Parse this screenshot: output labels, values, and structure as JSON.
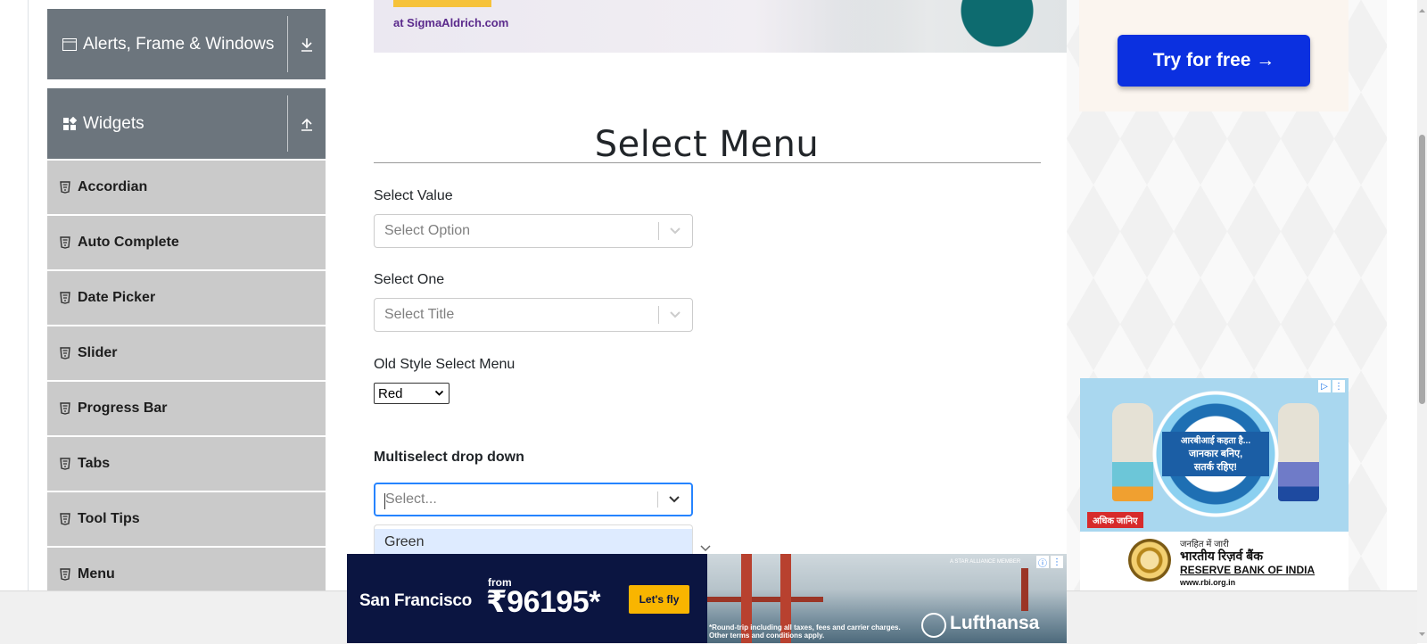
{
  "sidebar": {
    "groups": [
      {
        "label": "Alerts, Frame & Windows",
        "icon": "window-icon",
        "toggle_icon": "expand-down-icon"
      },
      {
        "label": "Widgets",
        "icon": "widgets-grid-icon",
        "toggle_icon": "collapse-up-icon"
      }
    ],
    "items": [
      {
        "label": "Accordian"
      },
      {
        "label": "Auto Complete"
      },
      {
        "label": "Date Picker"
      },
      {
        "label": "Slider"
      },
      {
        "label": "Progress Bar"
      },
      {
        "label": "Tabs"
      },
      {
        "label": "Tool Tips"
      },
      {
        "label": "Menu"
      }
    ]
  },
  "top_ad": {
    "url": "at SigmaAldrich.com"
  },
  "main": {
    "title": "Select Menu",
    "select_value": {
      "label": "Select Value",
      "placeholder": "Select Option"
    },
    "select_one": {
      "label": "Select One",
      "placeholder": "Select Title"
    },
    "old_style": {
      "label": "Old Style Select Menu",
      "value": "Red"
    },
    "multiselect": {
      "label": "Multiselect drop down",
      "placeholder": "Select...",
      "options": [
        "Green"
      ]
    }
  },
  "right_ad": {
    "button": "Try for free →"
  },
  "rbi_ad": {
    "banner_line1": "आरबीआई कहता है...",
    "banner_line2": "जानकार बनिए,",
    "banner_line3": "सतर्क रहिए!",
    "cta": "अधिक जानिए",
    "issuer_line": "जनहित में जारी",
    "bank_hindi": "भारतीय रिज़र्व बैंक",
    "bank_english": "RESERVE BANK OF INDIA",
    "url": "www.rbi.org.in"
  },
  "lufthansa_ad": {
    "city": "San Francisco",
    "from": "from",
    "price": "₹96195*",
    "button": "Let's fly",
    "fine_print_1": "*Round-trip including all taxes, fees and carrier charges.",
    "fine_print_2": "Other terms and conditions apply.",
    "brand": "Lufthansa",
    "alliance": "A STAR ALLIANCE MEMBER"
  },
  "colors": {
    "sidebar_group": "#6c757d",
    "sidebar_item": "#cacaca",
    "focus_border": "#2684ff",
    "option_highlight": "#deebff",
    "try_button": "#0b30e0"
  }
}
